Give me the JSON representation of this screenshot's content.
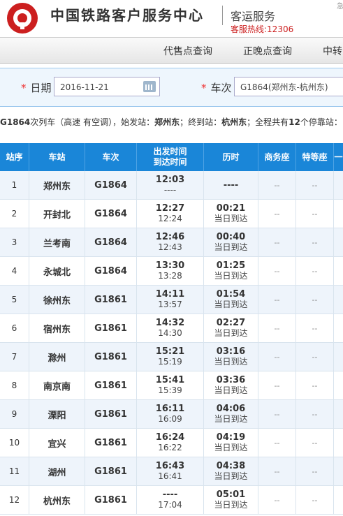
{
  "header": {
    "site_title": "中国铁路客户服务中心",
    "service_title": "客运服务",
    "hotline": "客服热线:12306",
    "corner": "急"
  },
  "nav": {
    "items": [
      "代售点查询",
      "正晚点查询",
      "中转"
    ]
  },
  "query": {
    "date_label": "日期",
    "date_value": "2016-11-21",
    "train_label": "车次",
    "train_value": "G1864(郑州东-杭州东)",
    "required_mark": "*"
  },
  "summary": {
    "train": "G1864",
    "part1": "次列车（高速 有空调），始发站：",
    "origin": "郑州东",
    "part2": "；终到站：",
    "terminal": "杭州东",
    "part3": "；全程共有",
    "count": "12",
    "part4": "个停靠站："
  },
  "table": {
    "headers": {
      "seq": "站序",
      "station": "车站",
      "train": "车次",
      "dep": "出发时间",
      "arr": "到达时间",
      "duration": "历时",
      "business": "商务座",
      "special": "特等座",
      "more": "一"
    },
    "rows": [
      {
        "seq": "1",
        "station": "郑州东",
        "train": "G1864",
        "dep": "12:03",
        "arr": "----",
        "duration": "----",
        "day": "",
        "business": "--",
        "special": "--"
      },
      {
        "seq": "2",
        "station": "开封北",
        "train": "G1864",
        "dep": "12:27",
        "arr": "12:24",
        "duration": "00:21",
        "day": "当日到达",
        "business": "--",
        "special": "--"
      },
      {
        "seq": "3",
        "station": "兰考南",
        "train": "G1864",
        "dep": "12:46",
        "arr": "12:43",
        "duration": "00:40",
        "day": "当日到达",
        "business": "--",
        "special": "--"
      },
      {
        "seq": "4",
        "station": "永城北",
        "train": "G1864",
        "dep": "13:30",
        "arr": "13:28",
        "duration": "01:25",
        "day": "当日到达",
        "business": "--",
        "special": "--"
      },
      {
        "seq": "5",
        "station": "徐州东",
        "train": "G1861",
        "dep": "14:11",
        "arr": "13:57",
        "duration": "01:54",
        "day": "当日到达",
        "business": "--",
        "special": "--"
      },
      {
        "seq": "6",
        "station": "宿州东",
        "train": "G1861",
        "dep": "14:32",
        "arr": "14:30",
        "duration": "02:27",
        "day": "当日到达",
        "business": "--",
        "special": "--"
      },
      {
        "seq": "7",
        "station": "滁州",
        "train": "G1861",
        "dep": "15:21",
        "arr": "15:19",
        "duration": "03:16",
        "day": "当日到达",
        "business": "--",
        "special": "--"
      },
      {
        "seq": "8",
        "station": "南京南",
        "train": "G1861",
        "dep": "15:41",
        "arr": "15:39",
        "duration": "03:36",
        "day": "当日到达",
        "business": "--",
        "special": "--"
      },
      {
        "seq": "9",
        "station": "溧阳",
        "train": "G1861",
        "dep": "16:11",
        "arr": "16:09",
        "duration": "04:06",
        "day": "当日到达",
        "business": "--",
        "special": "--"
      },
      {
        "seq": "10",
        "station": "宜兴",
        "train": "G1861",
        "dep": "16:24",
        "arr": "16:22",
        "duration": "04:19",
        "day": "当日到达",
        "business": "--",
        "special": "--"
      },
      {
        "seq": "11",
        "station": "湖州",
        "train": "G1861",
        "dep": "16:43",
        "arr": "16:41",
        "duration": "04:38",
        "day": "当日到达",
        "business": "--",
        "special": "--"
      },
      {
        "seq": "12",
        "station": "杭州东",
        "train": "G1861",
        "dep": "----",
        "arr": "17:04",
        "duration": "05:01",
        "day": "当日到达",
        "business": "--",
        "special": "--"
      }
    ]
  },
  "colors": {
    "brand_red": "#cc1f1f",
    "header_blue": "#1a86d8"
  },
  "icons": {
    "logo": "railway-logo-icon",
    "calendar": "calendar-icon"
  }
}
